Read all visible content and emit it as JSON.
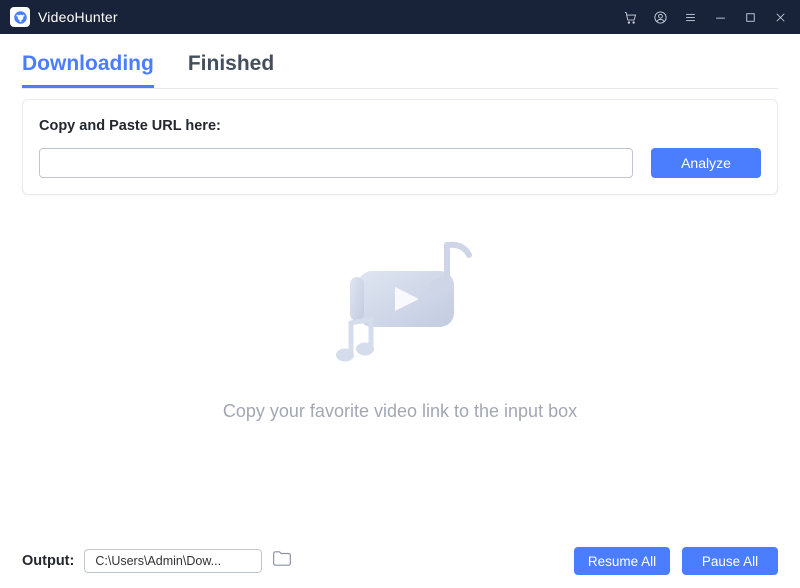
{
  "app": {
    "title": "VideoHunter"
  },
  "tabs": {
    "downloading": "Downloading",
    "finished": "Finished",
    "active": "downloading"
  },
  "card": {
    "label": "Copy and Paste URL here:",
    "analyze_label": "Analyze",
    "url_value": ""
  },
  "empty": {
    "text": "Copy your favorite video link to the input box"
  },
  "footer": {
    "output_label": "Output:",
    "output_path": "C:\\Users\\Admin\\Dow...",
    "resume_label": "Resume All",
    "pause_label": "Pause All"
  },
  "colors": {
    "accent": "#4a7dff",
    "titlebar": "#182238"
  }
}
